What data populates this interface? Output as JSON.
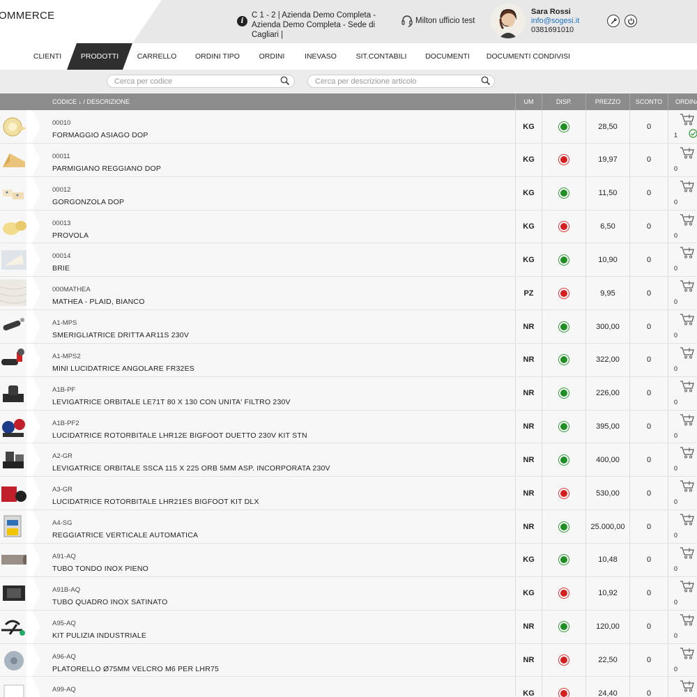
{
  "header": {
    "logo_text": "OMMERCE",
    "company_line": "C 1 - 2 | Azienda Demo Completa - Azienda Demo Completa - Sede di Cagliari |",
    "agent": "Milton ufficio test",
    "user": {
      "name": "Sara Rossi",
      "email": "info@sogesi.it",
      "phone": "0381691010"
    }
  },
  "nav": {
    "items": [
      "CLIENTI",
      "PRODOTTI",
      "CARRELLO",
      "ORDINI TIPO",
      "ORDINI",
      "INEVASO",
      "SIT.CONTABILI",
      "DOCUMENTI",
      "DOCUMENTI CONDIVISI"
    ],
    "active": "PRODOTTI"
  },
  "search": {
    "code_placeholder": "Cerca per codice",
    "desc_placeholder": "Cerca per descrizione articolo"
  },
  "table": {
    "columns": {
      "code_desc": "CODICE ↓ / DESCRIZIONE",
      "um": "UM",
      "disp": "DISP.",
      "prezzo": "PREZZO",
      "sconto": "SCONTO",
      "ordina": "ORDINA"
    },
    "rows": [
      {
        "code": "00010",
        "desc": "FORMAGGIO ASIAGO DOP",
        "um": "KG",
        "disp": "green",
        "price": "28,50",
        "discount": "0",
        "qty": "1",
        "in_cart": true,
        "thumb": "cheese-wheel"
      },
      {
        "code": "00011",
        "desc": "PARMIGIANO REGGIANO DOP",
        "um": "KG",
        "disp": "red",
        "price": "19,97",
        "discount": "0",
        "qty": "0",
        "in_cart": false,
        "thumb": "cheese-wedge"
      },
      {
        "code": "00012",
        "desc": "GORGONZOLA DOP",
        "um": "KG",
        "disp": "green",
        "price": "11,50",
        "discount": "0",
        "qty": "0",
        "in_cart": false,
        "thumb": "cheese-pieces"
      },
      {
        "code": "00013",
        "desc": "PROVOLA",
        "um": "KG",
        "disp": "red",
        "price": "6,50",
        "discount": "0",
        "qty": "0",
        "in_cart": false,
        "thumb": "cheese-ball"
      },
      {
        "code": "00014",
        "desc": "BRIE",
        "um": "KG",
        "disp": "green",
        "price": "10,90",
        "discount": "0",
        "qty": "0",
        "in_cart": false,
        "thumb": "cheese-soft"
      },
      {
        "code": "000MATHEA",
        "desc": "MATHEA - PLAID, BIANCO",
        "um": "PZ",
        "disp": "red",
        "price": "9,95",
        "discount": "0",
        "qty": "0",
        "in_cart": false,
        "thumb": "blanket"
      },
      {
        "code": "A1-MPS",
        "desc": "SMERIGLIATRICE DRITTA AR11S 230V",
        "um": "NR",
        "disp": "green",
        "price": "300,00",
        "discount": "0",
        "qty": "0",
        "in_cart": false,
        "thumb": "tool-straight"
      },
      {
        "code": "A1-MPS2",
        "desc": "MINI LUCIDATRICE ANGOLARE FR32ES",
        "um": "NR",
        "disp": "green",
        "price": "322,00",
        "discount": "0",
        "qty": "0",
        "in_cart": false,
        "thumb": "tool-angle"
      },
      {
        "code": "A1B-PF",
        "desc": "LEVIGATRICE ORBITALE LE71T 80 X 130 CON UNITA' FILTRO 230V",
        "um": "NR",
        "disp": "green",
        "price": "226,00",
        "discount": "0",
        "qty": "0",
        "in_cart": false,
        "thumb": "tool-sander"
      },
      {
        "code": "A1B-PF2",
        "desc": "LUCIDATRICE ROTORBITALE LHR12E BIGFOOT DUETTO 230V KIT STN",
        "um": "NR",
        "disp": "green",
        "price": "395,00",
        "discount": "0",
        "qty": "0",
        "in_cart": false,
        "thumb": "tool-kit"
      },
      {
        "code": "A2-GR",
        "desc": "LEVIGATRICE ORBITALE SSCA 115 X 225 ORB 5MM ASP. INCORPORATA 230V",
        "um": "NR",
        "disp": "green",
        "price": "400,00",
        "discount": "0",
        "qty": "0",
        "in_cart": false,
        "thumb": "tool-sander2"
      },
      {
        "code": "A3-GR",
        "desc": "LUCIDATRICE ROTORBITALE LHR21ES BIGFOOT KIT DLX",
        "um": "NR",
        "disp": "red",
        "price": "530,00",
        "discount": "0",
        "qty": "0",
        "in_cart": false,
        "thumb": "tool-case"
      },
      {
        "code": "A4-SG",
        "desc": "REGGIATRICE VERTICALE AUTOMATICA",
        "um": "NR",
        "disp": "green",
        "price": "25.000,00",
        "discount": "0",
        "qty": "0",
        "in_cart": false,
        "thumb": "machine"
      },
      {
        "code": "A91-AQ",
        "desc": "TUBO TONDO INOX PIENO",
        "um": "KG",
        "disp": "green",
        "price": "10,48",
        "discount": "0",
        "qty": "0",
        "in_cart": false,
        "thumb": "tube-round"
      },
      {
        "code": "A91B-AQ",
        "desc": "TUBO QUADRO INOX SATINATO",
        "um": "KG",
        "disp": "red",
        "price": "10,92",
        "discount": "0",
        "qty": "0",
        "in_cart": false,
        "thumb": "tube-square"
      },
      {
        "code": "A95-AQ",
        "desc": "KIT PULIZIA INDUSTRIALE",
        "um": "NR",
        "disp": "green",
        "price": "120,00",
        "discount": "0",
        "qty": "0",
        "in_cart": false,
        "thumb": "clean-kit"
      },
      {
        "code": "A96-AQ",
        "desc": "PLATORELLO Ø75MM VELCRO M6 PER LHR75",
        "um": "NR",
        "disp": "red",
        "price": "22,50",
        "discount": "0",
        "qty": "0",
        "in_cart": false,
        "thumb": "pad"
      },
      {
        "code": "A99-AQ",
        "desc": "",
        "um": "KG",
        "disp": "red",
        "price": "24,40",
        "discount": "0",
        "qty": "0",
        "in_cart": false,
        "thumb": "box"
      }
    ]
  },
  "colors": {
    "nav_active": "#2f2f2f",
    "table_header": "#8c8c8c",
    "available": "#1f8f24",
    "unavailable": "#d51f1f",
    "link": "#1e73c8"
  }
}
